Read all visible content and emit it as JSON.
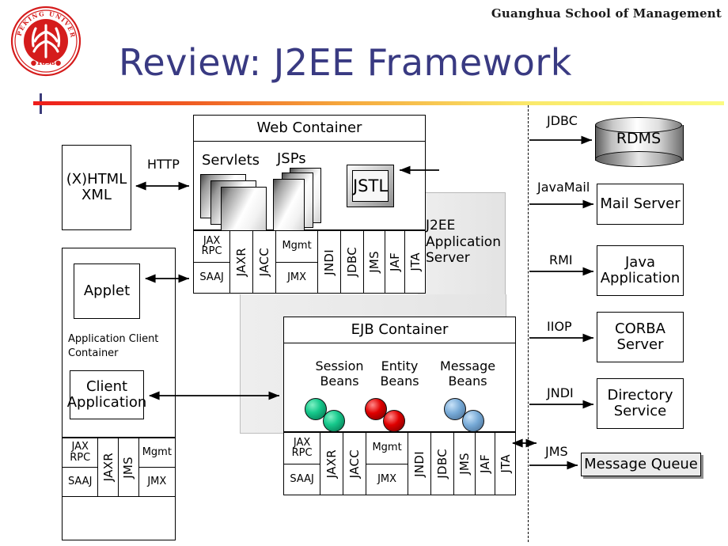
{
  "header": {
    "school": "Guanghua School of Management",
    "title": "Review: J2EE Framework",
    "logo_alt": "peking-university-seal",
    "logo_outer_text": "PEKING UNIVERSITY",
    "logo_year": "1898"
  },
  "colors": {
    "title": "#393a82",
    "rule_start": "#ee1c1c",
    "rule_end": "#fbfb82",
    "panel_gray": "#ebebeb",
    "session_bean": "#16c98c",
    "entity_bean": "#e00000",
    "message_bean": "#76a9d6"
  },
  "client_tier": {
    "browser_box": "(X)HTML\nXML",
    "browser_line1": "(X)HTML",
    "browser_line2": "XML",
    "http_label": "HTTP",
    "container_label_line1": "Application  Client",
    "container_label_line2": "Container",
    "applet": "Applet",
    "client_app_line1": "Client",
    "client_app_line2": "Application",
    "apis": [
      {
        "type": "split",
        "top": "JAX\nRPC",
        "top_l1": "JAX",
        "top_l2": "RPC",
        "bottom": "SAAJ"
      },
      {
        "type": "vertical",
        "label": "JAXR"
      },
      {
        "type": "vertical",
        "label": "JMS"
      },
      {
        "type": "split",
        "top": "Mgmt",
        "bottom": "JMX"
      }
    ]
  },
  "web_container": {
    "title": "Web Container",
    "servlets": "Servlets",
    "jsps": "JSPs",
    "jstl": "JSTL",
    "apis": [
      {
        "type": "split",
        "top_l1": "JAX",
        "top_l2": "RPC",
        "bottom": "SAAJ"
      },
      {
        "type": "vertical",
        "label": "JAXR"
      },
      {
        "type": "vertical",
        "label": "JACC"
      },
      {
        "type": "split",
        "top_l1": "Mgmt",
        "top_l2": "",
        "bottom": "JMX"
      },
      {
        "type": "vertical",
        "label": "JNDI"
      },
      {
        "type": "vertical",
        "label": "JDBC"
      },
      {
        "type": "vertical",
        "label": "JMS"
      },
      {
        "type": "vertical",
        "label": "JAF"
      },
      {
        "type": "vertical",
        "label": "JTA"
      }
    ]
  },
  "app_server": {
    "label_l1": "J2EE",
    "label_l2": "Application",
    "label_l3": "Server"
  },
  "ejb_container": {
    "title": "EJB Container",
    "groups": [
      {
        "name_l1": "Session",
        "name_l2": "Beans",
        "color": "green"
      },
      {
        "name_l1": "Entity",
        "name_l2": "Beans",
        "color": "red"
      },
      {
        "name_l1": "Message",
        "name_l2": "Beans",
        "color": "blue"
      }
    ],
    "apis": [
      {
        "type": "split",
        "top_l1": "JAX",
        "top_l2": "RPC",
        "bottom": "SAAJ"
      },
      {
        "type": "vertical",
        "label": "JAXR"
      },
      {
        "type": "vertical",
        "label": "JACC"
      },
      {
        "type": "split",
        "top_l1": "Mgmt",
        "top_l2": "",
        "bottom": "JMX"
      },
      {
        "type": "vertical",
        "label": "JNDI"
      },
      {
        "type": "vertical",
        "label": "JDBC"
      },
      {
        "type": "vertical",
        "label": "JMS"
      },
      {
        "type": "vertical",
        "label": "JAF"
      },
      {
        "type": "vertical",
        "label": "JTA"
      }
    ]
  },
  "eis_tier": [
    {
      "protocol": "JDBC",
      "system": "RDMS",
      "shape": "cylinder"
    },
    {
      "protocol": "JavaMail",
      "system": "Mail Server",
      "shape": "box"
    },
    {
      "protocol": "RMI",
      "system_l1": "Java",
      "system_l2": "Application",
      "shape": "box"
    },
    {
      "protocol": "IIOP",
      "system_l1": "CORBA",
      "system_l2": "Server",
      "shape": "box"
    },
    {
      "protocol": "JNDI",
      "system_l1": "Directory",
      "system_l2": "Service",
      "shape": "box"
    },
    {
      "protocol": "JMS",
      "system": "Message Queue",
      "shape": "shadow-box"
    }
  ]
}
